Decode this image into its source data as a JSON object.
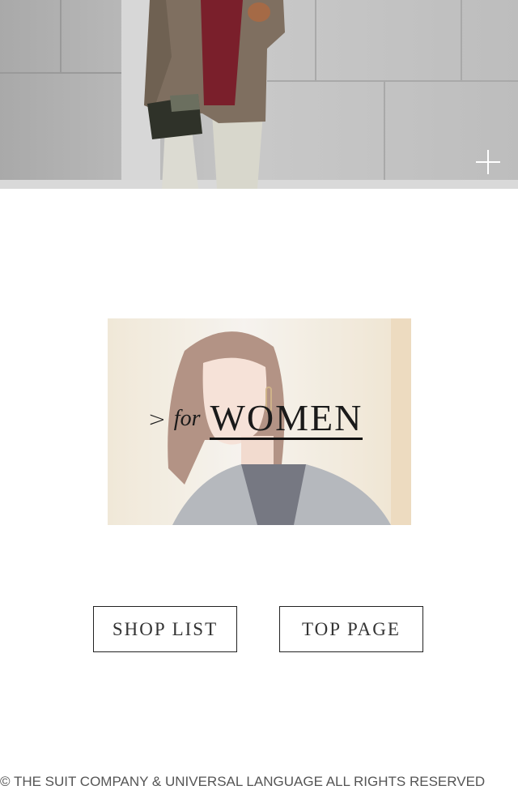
{
  "hero": {
    "image": "man-in-tweed-jacket-photo",
    "expand_icon": "plus-icon"
  },
  "women_banner": {
    "image": "woman-portrait-photo",
    "arrow": ">",
    "prefix": "for",
    "title": "WOMEN"
  },
  "buttons": {
    "shop_list": "SHOP LIST",
    "top_page": "TOP PAGE"
  },
  "footer": {
    "copyright": "© THE SUIT COMPANY & UNIVERSAL LANGUAGE ALL RIGHTS RESERVED"
  }
}
